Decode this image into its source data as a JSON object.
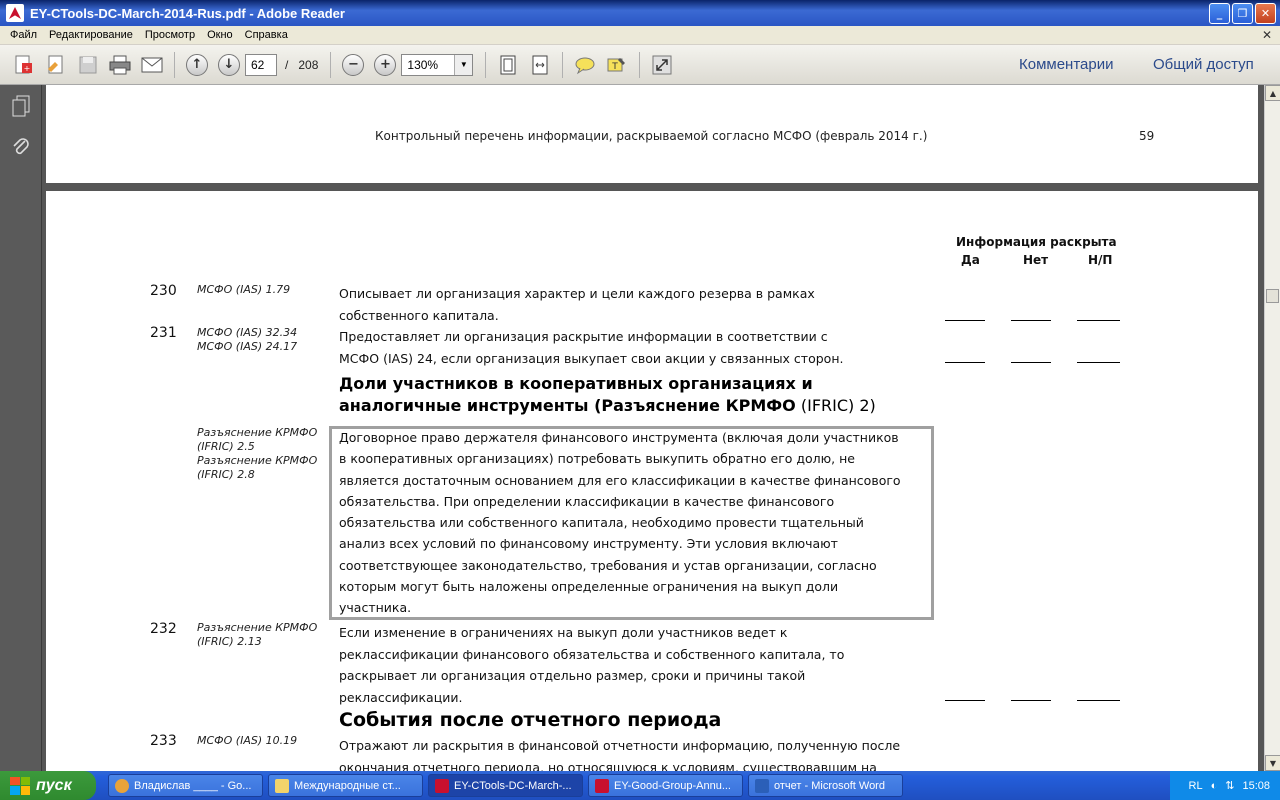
{
  "window": {
    "title": "EY-CTools-DC-March-2014-Rus.pdf - Adobe Reader"
  },
  "menu": [
    "Файл",
    "Редактирование",
    "Просмотр",
    "Окно",
    "Справка"
  ],
  "toolbar": {
    "page_current": "62",
    "page_separator": "/",
    "page_total": "208",
    "zoom": "130%",
    "comments": "Комментарии",
    "share": "Общий доступ"
  },
  "page1": {
    "header": "Контрольный перечень информации, раскрываемой согласно МСФО (февраль 2014 г.)",
    "page_number": "59"
  },
  "columns": {
    "heading": "Информация раскрыта",
    "yes": "Да",
    "no": "Нет",
    "na": "Н/П"
  },
  "rows": [
    {
      "num": "230",
      "ref": [
        "МСФО (IAS) 1.79"
      ],
      "text": [
        "Описывает ли организация характер и цели каждого резерва в рамках",
        "собственного капитала."
      ]
    },
    {
      "num": "231",
      "ref": [
        "МСФО (IAS) 32.34",
        "МСФО (IAS) 24.17"
      ],
      "text": [
        "Предоставляет ли организация раскрытие информации в соответствии с",
        "МСФО (IAS) 24, если организация выкупает свои акции у связанных сторон."
      ]
    }
  ],
  "section1": {
    "line1": "Доли участников в кооперативных организациях и",
    "line2_bold": "аналогичные инструменты (Разъяснение КРМФО",
    "line2_light": " (IFRIC) 2)"
  },
  "boxed": {
    "ref": [
      "Разъяснение КРМФО",
      "(IFRIC) 2.5",
      "Разъяснение КРМФО",
      "(IFRIC) 2.8"
    ],
    "text": [
      "Договорное право держателя финансового инструмента (включая доли участников",
      "в кооперативных организациях) потребовать выкупить обратно его долю, не",
      "является достаточным основанием для его классификации в качестве финансового",
      "обязательства. При определении классификации в качестве финансового",
      "обязательства или собственного капитала, необходимо провести тщательный",
      "анализ всех условий по финансовому инструменту. Эти условия включают",
      "соответствующее законодательство, требования и устав организации, согласно",
      "которым могут быть наложены определенные ограничения на выкуп доли",
      "участника."
    ]
  },
  "row232": {
    "num": "232",
    "ref": [
      "Разъяснение КРМФО",
      "(IFRIC) 2.13"
    ],
    "text": [
      "Если изменение в ограничениях на выкуп доли участников ведет к",
      "реклассификации финансового обязательства и собственного капитала, то",
      "раскрывает ли организация отдельно размер, сроки и причины такой",
      "реклассификации."
    ]
  },
  "section2": {
    "title": "События после отчетного периода"
  },
  "row233": {
    "num": "233",
    "ref": [
      "МСФО (IAS) 10.19"
    ],
    "text": [
      "Отражают ли раскрытия в финансовой отчетности информацию, полученную после",
      "окончания отчетного периода, но относящуюся к условиям, существовавшим на"
    ]
  },
  "taskbar": {
    "start": "пуск",
    "tasks": [
      {
        "label": "Владислав ____ - Go...",
        "color": "#e8a33a"
      },
      {
        "label": "Международные ст...",
        "color": "#f2d36b"
      },
      {
        "label": "EY-CTools-DC-March-...",
        "color": "#c8102e"
      },
      {
        "label": "EY-Good-Group-Annu...",
        "color": "#c8102e"
      },
      {
        "label": "отчет - Microsoft Word",
        "color": "#2b5fb8"
      }
    ],
    "lang": "RL",
    "clock": "15:08"
  }
}
